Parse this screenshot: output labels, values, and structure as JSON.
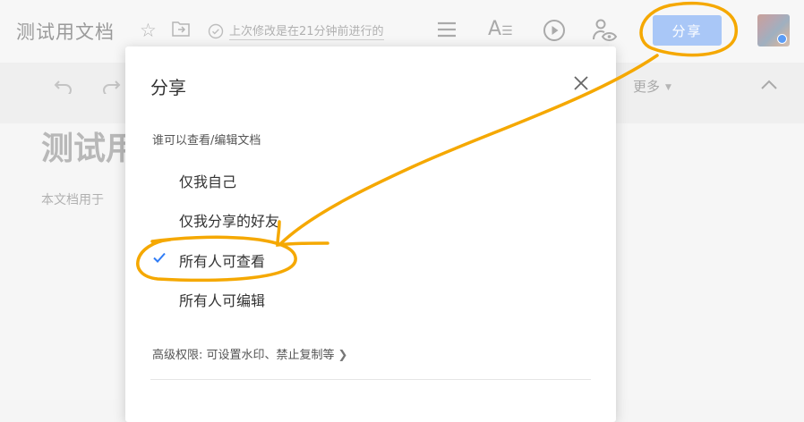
{
  "header": {
    "doc_title": "测试用文档",
    "saved_status": "上次修改是在21分钟前进行的",
    "share_label": "分享"
  },
  "toolbar": {
    "more_label": "更多"
  },
  "document": {
    "heading": "测试用文档",
    "body": "本文档用于"
  },
  "share_dialog": {
    "title": "分享",
    "section_label": "谁可以查看/编辑文档",
    "options": [
      {
        "label": "仅我自己",
        "selected": false
      },
      {
        "label": "仅我分享的好友",
        "selected": false
      },
      {
        "label": "所有人可查看",
        "selected": true
      },
      {
        "label": "所有人可编辑",
        "selected": false
      }
    ],
    "advanced_label": "高级权限: 可设置水印、禁止复制等"
  },
  "colors": {
    "accent": "#2f7cf6",
    "share_button_bg": "#a9c7f7",
    "annotation": "#f5a800"
  }
}
